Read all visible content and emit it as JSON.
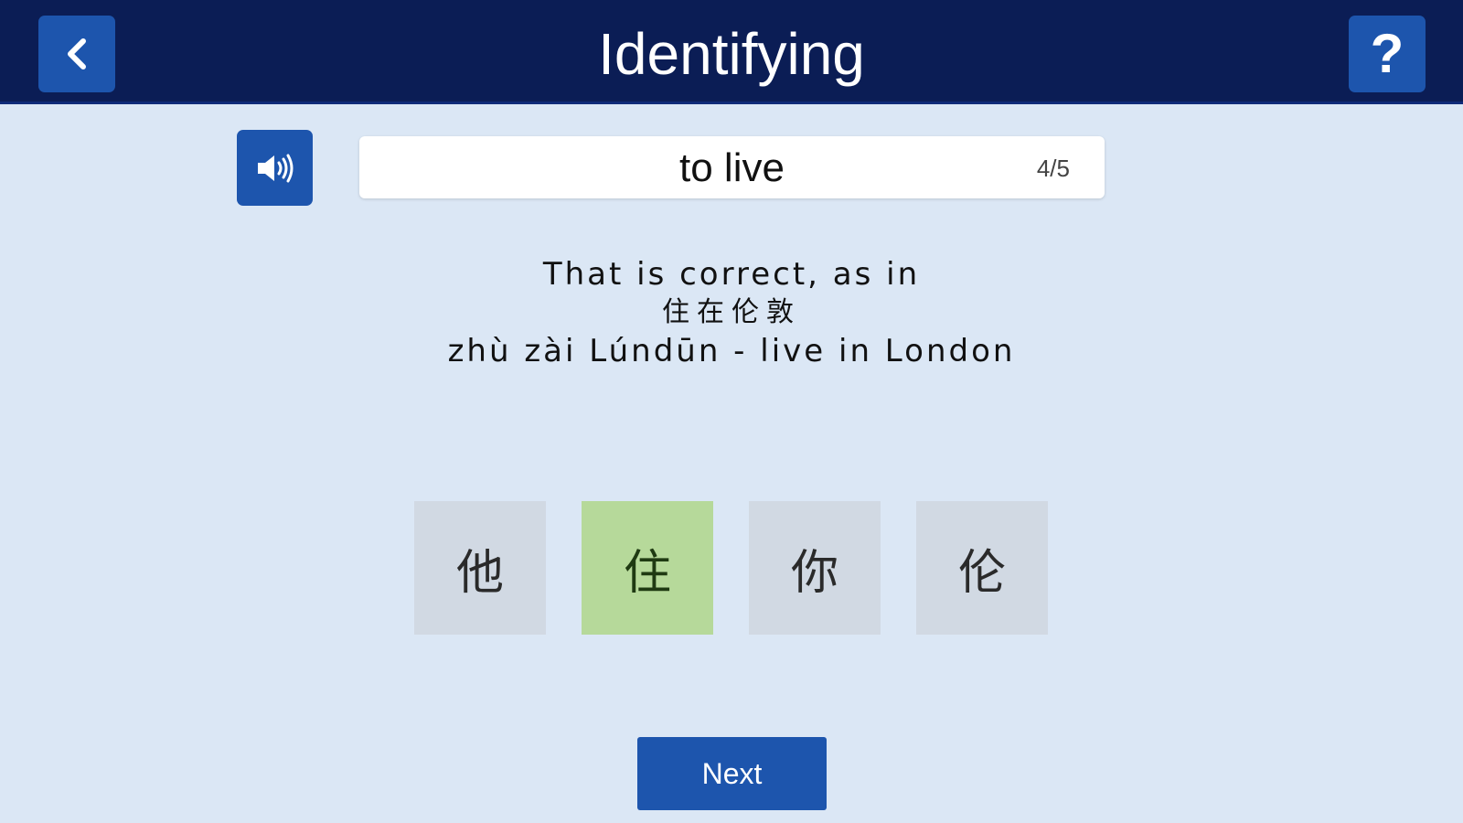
{
  "header": {
    "title": "Identifying",
    "back_icon": "chevron-left-icon",
    "help_label": "?"
  },
  "prompt": {
    "sound_icon": "speaker-icon",
    "word": "to live",
    "progress": "4/5"
  },
  "feedback": {
    "line1": "That is correct, as in",
    "hanzi": "住在伦敦",
    "line3": "zhù zài Lúndūn - live in London"
  },
  "choices": [
    {
      "char": "他",
      "state": "default"
    },
    {
      "char": "住",
      "state": "correct"
    },
    {
      "char": "你",
      "state": "default"
    },
    {
      "char": "伦",
      "state": "default"
    }
  ],
  "next_label": "Next",
  "colors": {
    "header_bg": "#0b1d55",
    "button_blue": "#1d55ad",
    "page_bg": "#dbe7f5",
    "choice_default": "#d1d9e3",
    "choice_correct": "#b6d99a"
  }
}
